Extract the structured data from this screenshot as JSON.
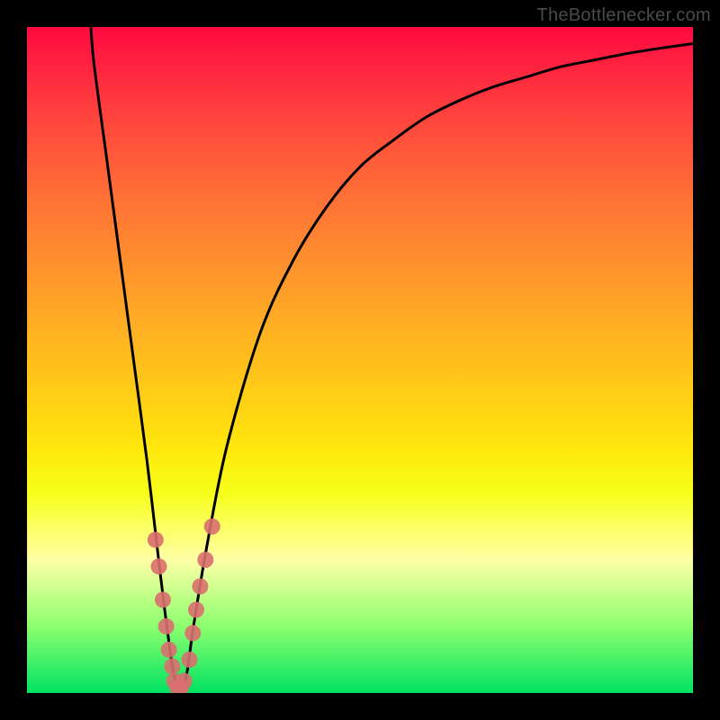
{
  "watermark": "TheBottlenecker.com",
  "chart_data": {
    "type": "line",
    "title": "",
    "xlabel": "",
    "ylabel": "",
    "xlim": [
      0,
      100
    ],
    "ylim": [
      0,
      100
    ],
    "series": [
      {
        "name": "curve",
        "x": [
          9.5,
          10,
          12,
          14,
          16,
          18,
          20,
          21,
          22,
          23,
          24,
          25,
          27,
          30,
          35,
          40,
          45,
          50,
          55,
          60,
          65,
          70,
          75,
          80,
          85,
          90,
          95,
          100
        ],
        "y": [
          102,
          95,
          80,
          65,
          50,
          35,
          18,
          10,
          3,
          0,
          3,
          10,
          22,
          37,
          54,
          65,
          73,
          79,
          83,
          86.5,
          89,
          91,
          92.5,
          94,
          95,
          96,
          96.8,
          97.5
        ]
      },
      {
        "name": "dots-left",
        "x": [
          19.3,
          19.8,
          20.4,
          20.9,
          21.3,
          21.8
        ],
        "y": [
          23,
          19,
          14,
          10,
          6.5,
          4
        ]
      },
      {
        "name": "dots-right",
        "x": [
          24.4,
          24.9,
          25.4,
          26.0,
          26.8,
          27.8
        ],
        "y": [
          5,
          9,
          12.5,
          16,
          20,
          25
        ]
      },
      {
        "name": "dots-bottom",
        "x": [
          22.1,
          22.6,
          23.1,
          23.6
        ],
        "y": [
          1.8,
          0.8,
          0.8,
          1.8
        ]
      }
    ],
    "background_gradient": {
      "top": "#ff0a3f",
      "bottom": "#00e262"
    },
    "dot_color": "#d96f6f",
    "curve_color": "#000000"
  }
}
